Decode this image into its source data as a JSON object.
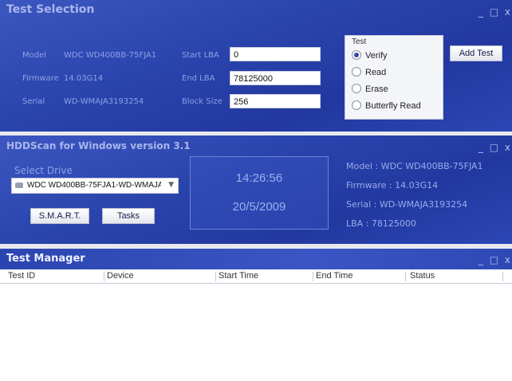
{
  "test_selection": {
    "title": "Test Selection",
    "window_controls": "_ □ x",
    "model_label": "Model",
    "model_value": "WDC WD400BB-75FJA1",
    "firmware_label": "Firmware",
    "firmware_value": "14.03G14",
    "serial_label": "Serial",
    "serial_value": "WD-WMAJA3193254",
    "start_lba_label": "Start LBA",
    "start_lba_value": "0",
    "end_lba_label": "End LBA",
    "end_lba_value": "78125000",
    "block_size_label": "Block Size",
    "block_size_value": "256",
    "test_group_label": "Test",
    "options": [
      {
        "label": "Verify",
        "checked": true
      },
      {
        "label": "Read",
        "checked": false
      },
      {
        "label": "Erase",
        "checked": false
      },
      {
        "label": "Butterfly Read",
        "checked": false
      }
    ],
    "add_test_label": "Add Test"
  },
  "hddscan": {
    "title": "HDDScan for Windows version 3.1",
    "window_controls": "_ □ x",
    "select_drive_label": "Select Drive",
    "drive_value": "WDC WD400BB-75FJA1-WD-WMAJA",
    "smart_label": "S.M.A.R.T.",
    "tasks_label": "Tasks",
    "time": "14:26:56",
    "date": "20/5/2009",
    "model_text": "Model : WDC WD400BB-75FJA1",
    "firmware_text": "Firmware : 14.03G14",
    "serial_text": "Serial : WD-WMAJA3193254",
    "lba_text": "LBA : 78125000"
  },
  "test_manager": {
    "title": "Test Manager",
    "window_controls": "_ □ x",
    "columns": [
      "Test ID",
      "Device",
      "Start Time",
      "End Time",
      "Status"
    ]
  },
  "colors": {
    "panel_blue": "#2a44ad",
    "title_text": "#a9b6ec"
  }
}
